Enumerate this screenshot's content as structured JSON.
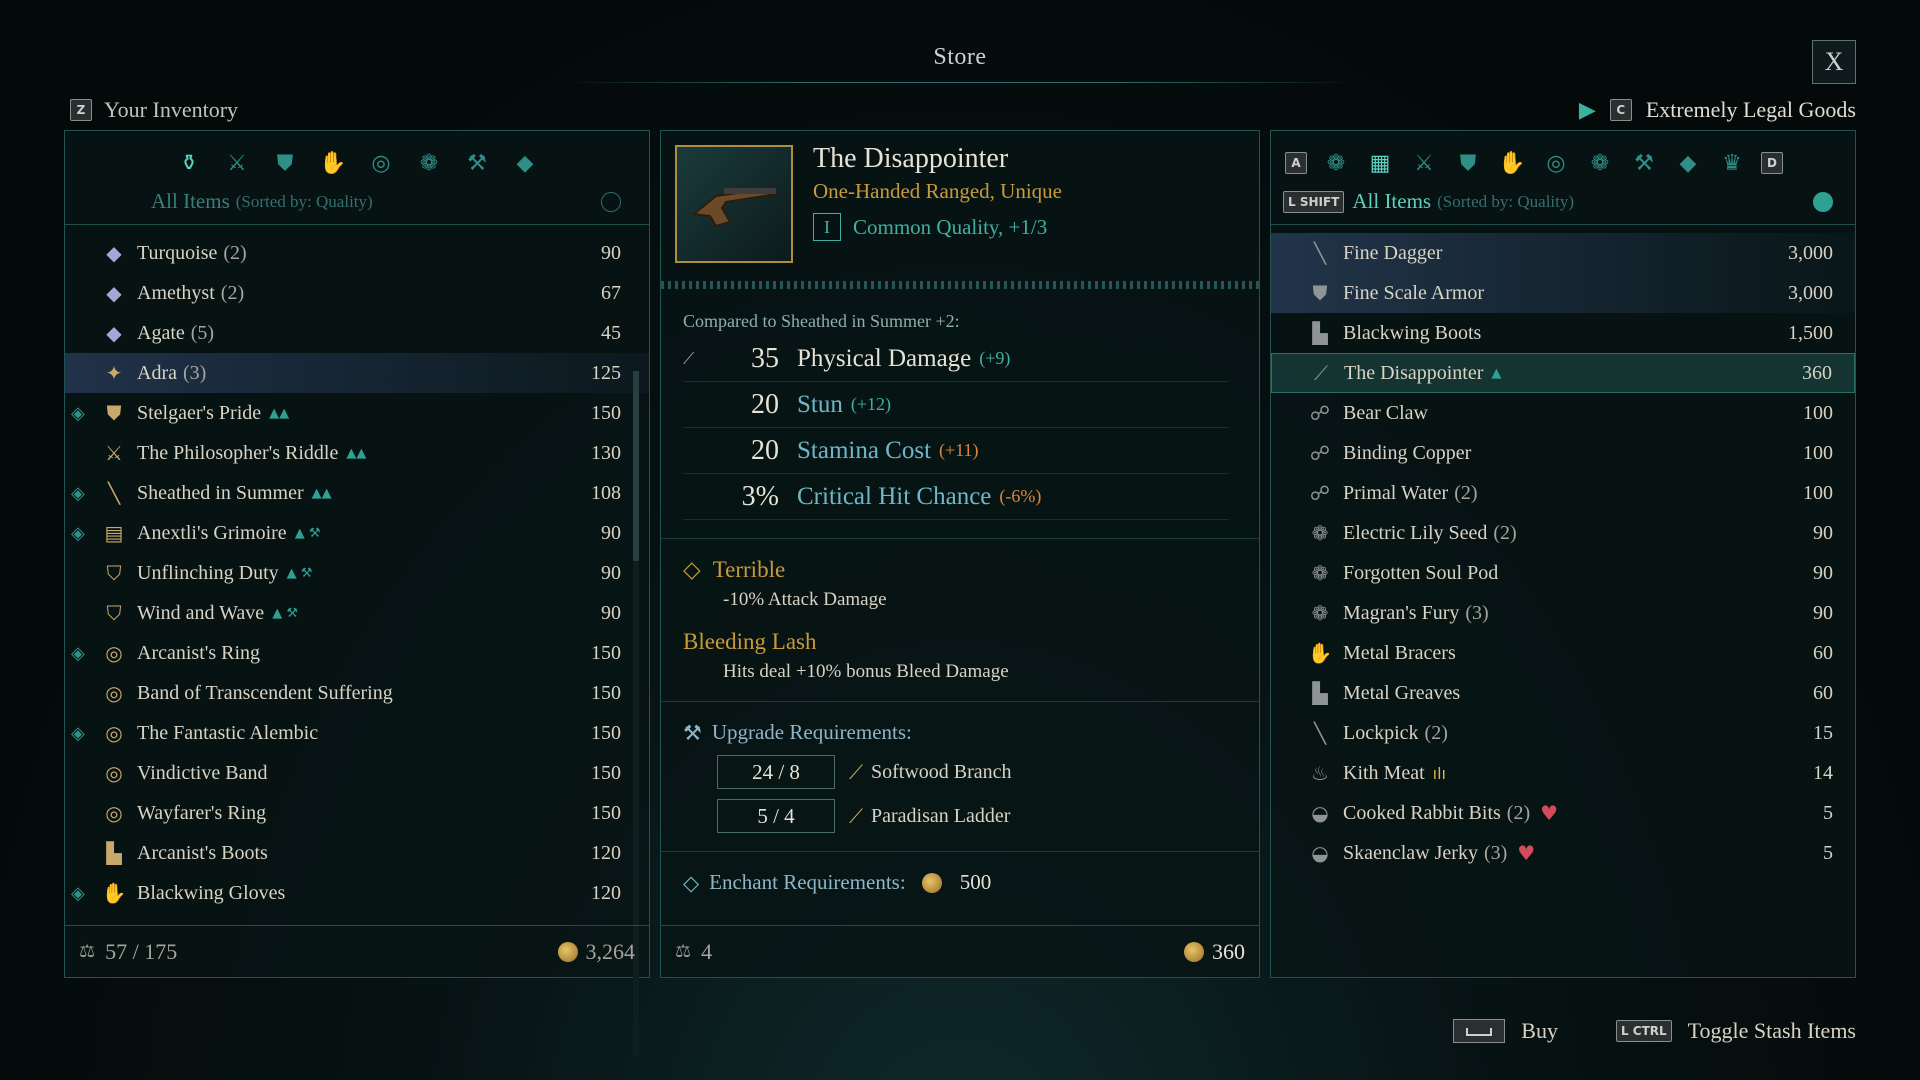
{
  "header": {
    "title": "Store",
    "close_label": "X"
  },
  "inventory": {
    "key": "Z",
    "title": "Your Inventory",
    "category_icons": [
      "all-items-icon",
      "weapons-icon",
      "armor-icon",
      "gloves-icon",
      "accessories-icon",
      "consumables-icon",
      "anvil-icon",
      "gem-icon"
    ],
    "sort_label": "All Items",
    "sort_sub": "(Sorted by: Quality)",
    "items": [
      {
        "name": "Turquoise",
        "qty": "(2)",
        "value": "90",
        "icon": "gem-icon",
        "glyph": "◆",
        "new": false,
        "tags": ""
      },
      {
        "name": "Amethyst",
        "qty": "(2)",
        "value": "67",
        "icon": "gem-icon",
        "glyph": "◆",
        "new": false,
        "tags": ""
      },
      {
        "name": "Agate",
        "qty": "(5)",
        "value": "45",
        "icon": "gem-icon",
        "glyph": "◆",
        "new": false,
        "tags": ""
      },
      {
        "name": "Adra",
        "qty": "(3)",
        "value": "125",
        "icon": "adra-icon",
        "glyph": "✦",
        "new": false,
        "tags": "",
        "selected": true
      },
      {
        "name": "Stelgaer's Pride",
        "qty": "",
        "value": "150",
        "icon": "armor-icon",
        "glyph": "⛊",
        "new": true,
        "tags": "▲▲"
      },
      {
        "name": "The Philosopher's Riddle",
        "qty": "",
        "value": "130",
        "icon": "sword-icon",
        "glyph": "⚔",
        "new": false,
        "tags": "▲▲"
      },
      {
        "name": "Sheathed in Summer",
        "qty": "",
        "value": "108",
        "icon": "dagger-icon",
        "glyph": "╲",
        "new": true,
        "tags": "▲▲"
      },
      {
        "name": "Anextli's Grimoire",
        "qty": "",
        "value": "90",
        "icon": "grimoire-icon",
        "glyph": "▤",
        "new": true,
        "tags": "▲ ⚒"
      },
      {
        "name": "Unflinching Duty",
        "qty": "",
        "value": "90",
        "icon": "shield-icon",
        "glyph": "⛉",
        "new": false,
        "tags": "▲ ⚒"
      },
      {
        "name": "Wind and Wave",
        "qty": "",
        "value": "90",
        "icon": "shield-icon",
        "glyph": "⛉",
        "new": false,
        "tags": "▲ ⚒"
      },
      {
        "name": "Arcanist's Ring",
        "qty": "",
        "value": "150",
        "icon": "ring-icon",
        "glyph": "◎",
        "new": true,
        "tags": ""
      },
      {
        "name": "Band of Transcendent Suffering",
        "qty": "",
        "value": "150",
        "icon": "ring-icon",
        "glyph": "◎",
        "new": false,
        "tags": ""
      },
      {
        "name": "The Fantastic Alembic",
        "qty": "",
        "value": "150",
        "icon": "ring-icon",
        "glyph": "◎",
        "new": true,
        "tags": ""
      },
      {
        "name": "Vindictive Band",
        "qty": "",
        "value": "150",
        "icon": "ring-icon",
        "glyph": "◎",
        "new": false,
        "tags": ""
      },
      {
        "name": "Wayfarer's Ring",
        "qty": "",
        "value": "150",
        "icon": "ring-icon",
        "glyph": "◎",
        "new": false,
        "tags": ""
      },
      {
        "name": "Arcanist's Boots",
        "qty": "",
        "value": "120",
        "icon": "boots-icon",
        "glyph": "▙",
        "new": false,
        "tags": ""
      },
      {
        "name": "Blackwing Gloves",
        "qty": "",
        "value": "120",
        "icon": "gloves-icon",
        "glyph": "✋",
        "new": true,
        "tags": ""
      }
    ],
    "capacity": "57 / 175",
    "gold": "3,264"
  },
  "detail": {
    "name": "The Disappointer",
    "type": "One-Handed Ranged, Unique",
    "tier": "I",
    "quality": "Common Quality, +1/3",
    "compare_label": "Compared to Sheathed in Summer +2:",
    "stats": [
      {
        "value": "35",
        "label": "Physical Damage",
        "delta": "(+9)",
        "main": true,
        "neg": false,
        "icon": "dagger-icon",
        "glyph": "⟋"
      },
      {
        "value": "20",
        "label": "Stun",
        "delta": "(+12)",
        "main": false,
        "neg": false,
        "icon": "",
        "glyph": ""
      },
      {
        "value": "20",
        "label": "Stamina Cost",
        "delta": "(+11)",
        "main": false,
        "neg": true,
        "icon": "",
        "glyph": ""
      },
      {
        "value": "3%",
        "label": "Critical Hit Chance",
        "delta": "(-6%)",
        "main": false,
        "neg": true,
        "icon": "",
        "glyph": ""
      }
    ],
    "perk1_title": "Terrible",
    "perk1_desc": "-10% Attack Damage",
    "perk2_title": "Bleeding Lash",
    "perk2_desc": "Hits deal +10% bonus Bleed Damage",
    "upgrade_title": "Upgrade Requirements:",
    "upgrades": [
      {
        "count": "24 / 8",
        "name": "Softwood Branch"
      },
      {
        "count": "5 / 4",
        "name": "Paradisan Ladder"
      }
    ],
    "enchant_title": "Enchant Requirements:",
    "enchant_cost": "500",
    "weight": "4",
    "price": "360"
  },
  "vendor": {
    "key": "C",
    "title": "Extremely Legal Goods",
    "key_left": "A",
    "key_right": "D",
    "shift_key": "L SHIFT",
    "sort_label": "All Items",
    "sort_sub": "(Sorted by: Quality)",
    "items": [
      {
        "name": "Fine Dagger",
        "qty": "",
        "value": "3,000",
        "glyph": "╲",
        "hl": true
      },
      {
        "name": "Fine Scale Armor",
        "qty": "",
        "value": "3,000",
        "glyph": "⛊",
        "hl": true
      },
      {
        "name": "Blackwing Boots",
        "qty": "",
        "value": "1,500",
        "glyph": "▙",
        "hl": false
      },
      {
        "name": "The Disappointer",
        "qty": "",
        "value": "360",
        "glyph": "⟋",
        "active": true,
        "tag": "▲"
      },
      {
        "name": "Bear Claw",
        "qty": "",
        "value": "100",
        "glyph": "☍"
      },
      {
        "name": "Binding Copper",
        "qty": "",
        "value": "100",
        "glyph": "☍"
      },
      {
        "name": "Primal Water",
        "qty": "(2)",
        "value": "100",
        "glyph": "☍"
      },
      {
        "name": "Electric Lily Seed",
        "qty": "(2)",
        "value": "90",
        "glyph": "❁"
      },
      {
        "name": "Forgotten Soul Pod",
        "qty": "",
        "value": "90",
        "glyph": "❁"
      },
      {
        "name": "Magran's Fury",
        "qty": "(3)",
        "value": "90",
        "glyph": "❁"
      },
      {
        "name": "Metal Bracers",
        "qty": "",
        "value": "60",
        "glyph": "✋"
      },
      {
        "name": "Metal Greaves",
        "qty": "",
        "value": "60",
        "glyph": "▙"
      },
      {
        "name": "Lockpick",
        "qty": "(2)",
        "value": "15",
        "glyph": "╲"
      },
      {
        "name": "Kith Meat",
        "qty": "",
        "value": "14",
        "glyph": "♨",
        "gold": "ılı"
      },
      {
        "name": "Cooked Rabbit Bits",
        "qty": "(2)",
        "value": "5",
        "glyph": "◒",
        "heart": "♥"
      },
      {
        "name": "Skaenclaw Jerky",
        "qty": "(3)",
        "value": "5",
        "glyph": "◒",
        "heart": "♥"
      }
    ]
  },
  "footer_actions": {
    "buy_label": "Buy",
    "stash_key": "L CTRL",
    "stash_label": "Toggle Stash Items"
  }
}
